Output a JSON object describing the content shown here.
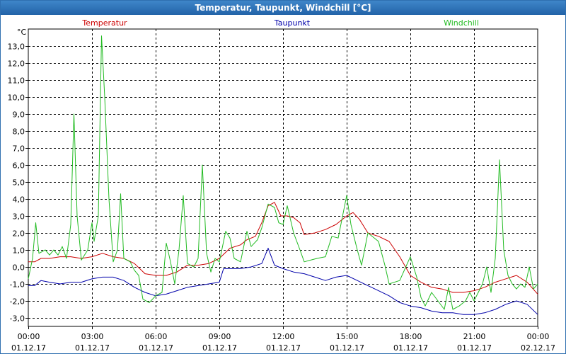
{
  "window": {
    "title": "Temperatur, Taupunkt, Windchill [°C]"
  },
  "chart_data": {
    "type": "line",
    "unit": "°C",
    "ylim": [
      -3.5,
      14.0
    ],
    "xlim": [
      0,
      24
    ],
    "yticks": [
      {
        "value": -3.0,
        "label": "-3,0"
      },
      {
        "value": -2.0,
        "label": "-2,0"
      },
      {
        "value": -1.0,
        "label": "-1,0"
      },
      {
        "value": 0.0,
        "label": "0,0"
      },
      {
        "value": 1.0,
        "label": "1,0"
      },
      {
        "value": 2.0,
        "label": "2,0"
      },
      {
        "value": 3.0,
        "label": "3,0"
      },
      {
        "value": 4.0,
        "label": "4,0"
      },
      {
        "value": 5.0,
        "label": "5,0"
      },
      {
        "value": 6.0,
        "label": "6,0"
      },
      {
        "value": 7.0,
        "label": "7,0"
      },
      {
        "value": 8.0,
        "label": "8,0"
      },
      {
        "value": 9.0,
        "label": "9,0"
      },
      {
        "value": 10.0,
        "label": "10,0"
      },
      {
        "value": 11.0,
        "label": "11,0"
      },
      {
        "value": 12.0,
        "label": "12,0"
      },
      {
        "value": 13.0,
        "label": "13,0"
      }
    ],
    "xticks": [
      {
        "value": 0,
        "time": "00:00",
        "date": "01.12.17"
      },
      {
        "value": 3,
        "time": "03:00",
        "date": "01.12.17"
      },
      {
        "value": 6,
        "time": "06:00",
        "date": "01.12.17"
      },
      {
        "value": 9,
        "time": "09:00",
        "date": "01.12.17"
      },
      {
        "value": 12,
        "time": "12:00",
        "date": "01.12.17"
      },
      {
        "value": 15,
        "time": "15:00",
        "date": "01.12.17"
      },
      {
        "value": 18,
        "time": "18:00",
        "date": "01.12.17"
      },
      {
        "value": 21,
        "time": "21:00",
        "date": "01.12.17"
      },
      {
        "value": 24,
        "time": "00:00",
        "date": "02.12.17"
      }
    ],
    "grid": true,
    "legend_position": "top",
    "series": [
      {
        "name": "Temperatur",
        "color": "#cc0000",
        "points": [
          [
            0,
            0.3
          ],
          [
            0.3,
            0.3
          ],
          [
            0.6,
            0.5
          ],
          [
            1.0,
            0.5
          ],
          [
            1.5,
            0.6
          ],
          [
            2.0,
            0.6
          ],
          [
            2.5,
            0.5
          ],
          [
            3.0,
            0.6
          ],
          [
            3.5,
            0.8
          ],
          [
            4.0,
            0.6
          ],
          [
            4.5,
            0.5
          ],
          [
            5.0,
            0.2
          ],
          [
            5.5,
            -0.4
          ],
          [
            6.0,
            -0.5
          ],
          [
            6.5,
            -0.5
          ],
          [
            7.0,
            -0.3
          ],
          [
            7.5,
            0.1
          ],
          [
            8.0,
            0.1
          ],
          [
            8.5,
            0.2
          ],
          [
            9.0,
            0.5
          ],
          [
            9.5,
            1.1
          ],
          [
            10.0,
            1.3
          ],
          [
            10.3,
            1.6
          ],
          [
            10.7,
            1.8
          ],
          [
            11.0,
            2.6
          ],
          [
            11.3,
            3.6
          ],
          [
            11.6,
            3.8
          ],
          [
            11.9,
            3.0
          ],
          [
            12.2,
            3.0
          ],
          [
            12.5,
            2.9
          ],
          [
            12.8,
            2.6
          ],
          [
            13.0,
            1.9
          ],
          [
            13.5,
            2.0
          ],
          [
            14.0,
            2.2
          ],
          [
            14.5,
            2.5
          ],
          [
            15.0,
            3.0
          ],
          [
            15.3,
            3.2
          ],
          [
            15.6,
            2.8
          ],
          [
            16.0,
            2.0
          ],
          [
            16.5,
            1.8
          ],
          [
            17.0,
            1.5
          ],
          [
            17.5,
            0.6
          ],
          [
            18.0,
            -0.5
          ],
          [
            18.5,
            -0.9
          ],
          [
            19.0,
            -1.2
          ],
          [
            19.5,
            -1.3
          ],
          [
            20.0,
            -1.5
          ],
          [
            20.5,
            -1.5
          ],
          [
            21.0,
            -1.4
          ],
          [
            21.5,
            -1.2
          ],
          [
            22.0,
            -0.9
          ],
          [
            22.5,
            -0.7
          ],
          [
            23.0,
            -0.5
          ],
          [
            23.5,
            -0.9
          ],
          [
            24.0,
            -1.6
          ]
        ]
      },
      {
        "name": "Taupunkt",
        "color": "#0000aa",
        "points": [
          [
            0,
            -1.1
          ],
          [
            0.3,
            -1.1
          ],
          [
            0.6,
            -0.8
          ],
          [
            1.0,
            -0.9
          ],
          [
            1.5,
            -1.0
          ],
          [
            2.0,
            -0.9
          ],
          [
            2.5,
            -0.9
          ],
          [
            3.0,
            -0.7
          ],
          [
            3.5,
            -0.6
          ],
          [
            4.0,
            -0.6
          ],
          [
            4.5,
            -0.8
          ],
          [
            5.0,
            -1.2
          ],
          [
            5.5,
            -1.5
          ],
          [
            6.0,
            -1.7
          ],
          [
            6.5,
            -1.6
          ],
          [
            7.0,
            -1.4
          ],
          [
            7.5,
            -1.2
          ],
          [
            8.0,
            -1.1
          ],
          [
            8.5,
            -1.0
          ],
          [
            9.0,
            -0.9
          ],
          [
            9.2,
            -0.1
          ],
          [
            9.5,
            -0.1
          ],
          [
            10.0,
            -0.1
          ],
          [
            10.5,
            0.0
          ],
          [
            11.0,
            0.2
          ],
          [
            11.3,
            1.1
          ],
          [
            11.6,
            0.1
          ],
          [
            12.0,
            -0.1
          ],
          [
            12.5,
            -0.3
          ],
          [
            13.0,
            -0.4
          ],
          [
            13.5,
            -0.6
          ],
          [
            14.0,
            -0.8
          ],
          [
            14.5,
            -0.6
          ],
          [
            15.0,
            -0.5
          ],
          [
            15.5,
            -0.8
          ],
          [
            16.0,
            -1.1
          ],
          [
            16.5,
            -1.4
          ],
          [
            17.0,
            -1.7
          ],
          [
            17.5,
            -2.1
          ],
          [
            18.0,
            -2.3
          ],
          [
            18.5,
            -2.4
          ],
          [
            19.0,
            -2.6
          ],
          [
            19.5,
            -2.7
          ],
          [
            20.0,
            -2.7
          ],
          [
            20.5,
            -2.8
          ],
          [
            21.0,
            -2.8
          ],
          [
            21.5,
            -2.7
          ],
          [
            22.0,
            -2.5
          ],
          [
            22.5,
            -2.2
          ],
          [
            23.0,
            -2.0
          ],
          [
            23.5,
            -2.2
          ],
          [
            24.0,
            -2.8
          ]
        ]
      },
      {
        "name": "Windchill",
        "color": "#22bb22",
        "points": [
          [
            0,
            -0.7
          ],
          [
            0.2,
            0.5
          ],
          [
            0.35,
            2.6
          ],
          [
            0.5,
            0.8
          ],
          [
            0.8,
            1.0
          ],
          [
            1.0,
            0.7
          ],
          [
            1.2,
            1.0
          ],
          [
            1.4,
            0.7
          ],
          [
            1.6,
            1.2
          ],
          [
            1.8,
            0.5
          ],
          [
            2.0,
            2.5
          ],
          [
            2.15,
            9.0
          ],
          [
            2.3,
            3.0
          ],
          [
            2.5,
            0.4
          ],
          [
            2.8,
            1.0
          ],
          [
            3.0,
            2.6
          ],
          [
            3.1,
            1.5
          ],
          [
            3.3,
            3.0
          ],
          [
            3.45,
            13.6
          ],
          [
            3.6,
            10.0
          ],
          [
            3.8,
            4.0
          ],
          [
            4.0,
            0.3
          ],
          [
            4.2,
            1.0
          ],
          [
            4.35,
            4.3
          ],
          [
            4.5,
            0.5
          ],
          [
            4.8,
            0.3
          ],
          [
            5.0,
            -0.2
          ],
          [
            5.2,
            -0.5
          ],
          [
            5.4,
            -1.9
          ],
          [
            5.7,
            -2.1
          ],
          [
            6.0,
            -1.7
          ],
          [
            6.3,
            -1.5
          ],
          [
            6.5,
            1.4
          ],
          [
            6.7,
            0.3
          ],
          [
            6.9,
            -1.0
          ],
          [
            7.1,
            1.0
          ],
          [
            7.3,
            4.2
          ],
          [
            7.5,
            0.2
          ],
          [
            7.8,
            0.0
          ],
          [
            8.0,
            0.5
          ],
          [
            8.2,
            6.0
          ],
          [
            8.4,
            0.8
          ],
          [
            8.6,
            -0.3
          ],
          [
            8.8,
            0.5
          ],
          [
            9.0,
            0.3
          ],
          [
            9.3,
            2.1
          ],
          [
            9.5,
            1.7
          ],
          [
            9.7,
            0.5
          ],
          [
            10.0,
            0.3
          ],
          [
            10.3,
            2.1
          ],
          [
            10.5,
            1.2
          ],
          [
            10.8,
            1.6
          ],
          [
            11.0,
            2.3
          ],
          [
            11.3,
            3.7
          ],
          [
            11.6,
            3.5
          ],
          [
            11.8,
            2.6
          ],
          [
            12.0,
            2.5
          ],
          [
            12.2,
            3.6
          ],
          [
            12.5,
            2.0
          ],
          [
            12.8,
            1.0
          ],
          [
            13.0,
            0.3
          ],
          [
            13.3,
            0.4
          ],
          [
            13.6,
            0.5
          ],
          [
            14.0,
            0.6
          ],
          [
            14.3,
            1.8
          ],
          [
            14.6,
            1.7
          ],
          [
            15.0,
            4.2
          ],
          [
            15.2,
            2.5
          ],
          [
            15.5,
            1.0
          ],
          [
            15.7,
            0.1
          ],
          [
            16.0,
            2.0
          ],
          [
            16.5,
            1.5
          ],
          [
            16.8,
            0.1
          ],
          [
            17.0,
            -1.0
          ],
          [
            17.5,
            -0.8
          ],
          [
            18.0,
            0.6
          ],
          [
            18.3,
            -0.6
          ],
          [
            18.5,
            -1.8
          ],
          [
            18.7,
            -2.3
          ],
          [
            19.0,
            -1.5
          ],
          [
            19.3,
            -2.0
          ],
          [
            19.6,
            -2.5
          ],
          [
            19.8,
            -1.2
          ],
          [
            20.0,
            -2.5
          ],
          [
            20.3,
            -2.3
          ],
          [
            20.6,
            -2.0
          ],
          [
            20.8,
            -1.5
          ],
          [
            21.0,
            -2.0
          ],
          [
            21.2,
            -1.5
          ],
          [
            21.4,
            -1.0
          ],
          [
            21.6,
            0.0
          ],
          [
            21.8,
            -1.5
          ],
          [
            22.0,
            0.5
          ],
          [
            22.2,
            6.3
          ],
          [
            22.4,
            1.0
          ],
          [
            22.6,
            -0.5
          ],
          [
            22.8,
            -1.0
          ],
          [
            23.0,
            -1.3
          ],
          [
            23.2,
            -1.0
          ],
          [
            23.4,
            -1.2
          ],
          [
            23.6,
            0.0
          ],
          [
            23.8,
            -1.3
          ],
          [
            24.0,
            -1.0
          ]
        ]
      }
    ]
  }
}
